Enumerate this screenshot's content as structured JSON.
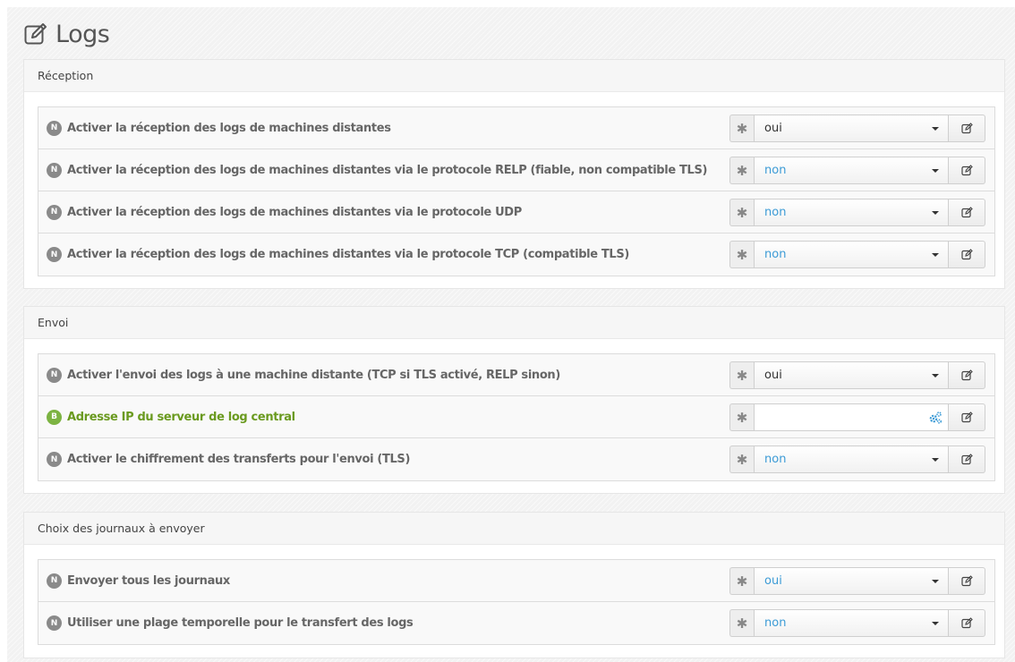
{
  "page": {
    "title": "Logs",
    "title_icon": "edit-icon"
  },
  "colors": {
    "blue_value": "#3c9bd6",
    "green_label": "#6a9a1f",
    "badge_gray": "#8a8a8a",
    "badge_green": "#7cb342"
  },
  "sections": [
    {
      "title": "Réception",
      "rows": [
        {
          "badge": "N",
          "label": "Activer la réception des logs de machines distantes",
          "control": "select",
          "value": "oui"
        },
        {
          "badge": "N",
          "label": "Activer la réception des logs de machines distantes via le protocole RELP (fiable, non compatible TLS)",
          "control": "select",
          "value": "non"
        },
        {
          "badge": "N",
          "label": "Activer la réception des logs de machines distantes via le protocole UDP",
          "control": "select",
          "value": "non"
        },
        {
          "badge": "N",
          "label": "Activer la réception des logs de machines distantes via le protocole TCP (compatible TLS)",
          "control": "select",
          "value": "non"
        }
      ]
    },
    {
      "title": "Envoi",
      "rows": [
        {
          "badge": "N",
          "label": "Activer l'envoi des logs à une machine distante (TCP si TLS activé, RELP sinon)",
          "control": "select",
          "value": "oui"
        },
        {
          "badge": "B",
          "label": "Adresse IP du serveur de log central",
          "control": "input",
          "value": ""
        },
        {
          "badge": "N",
          "label": "Activer le chiffrement des transferts pour l'envoi (TLS)",
          "control": "select",
          "value": "non"
        }
      ]
    },
    {
      "title": "Choix des journaux à envoyer",
      "rows": [
        {
          "badge": "N",
          "label": "Envoyer tous les journaux",
          "control": "select",
          "value": "oui"
        },
        {
          "badge": "N",
          "label": "Utiliser une plage temporelle pour le transfert des logs",
          "control": "select",
          "value": "non"
        }
      ]
    }
  ]
}
